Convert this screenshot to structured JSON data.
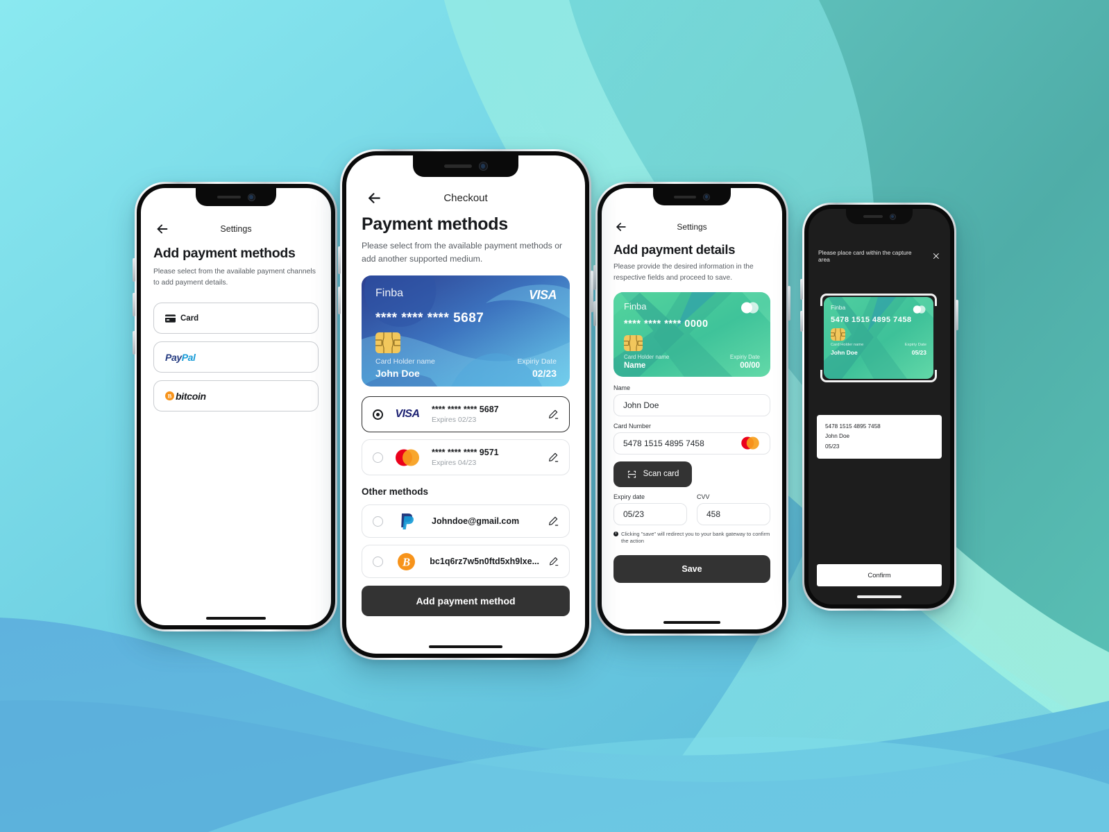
{
  "background": {
    "gradient_top_left": "#8AE9F0",
    "gradient_top_right": "#4FA8A5",
    "gradient_bottom_left": "#5DB1DB",
    "gradient_bottom_right": "#9BEFE3",
    "wave_mint": "#9EE9D2",
    "wave_cyan": "#7CE3EE",
    "wave_blue": "#5FB3DE"
  },
  "phone1": {
    "nav": {
      "back_icon": "arrow-left-icon",
      "title": "Settings"
    },
    "heading": "Add payment methods",
    "subtitle": "Please select from the available payment channels to add payment details.",
    "options": [
      {
        "id": "card",
        "label": "Card",
        "icon": "credit-card-icon"
      },
      {
        "id": "paypal",
        "label": "PayPal",
        "icon": "paypal-logo"
      },
      {
        "id": "bitcoin",
        "label": "bitcoin",
        "icon": "bitcoin-logo"
      }
    ]
  },
  "phone2": {
    "nav": {
      "back_icon": "arrow-left-icon",
      "title": "Checkout"
    },
    "heading": "Payment methods",
    "subtitle": "Please select from the available payment methods or add another supported medium.",
    "card": {
      "brand": "Finba",
      "network": "VISA",
      "number": "**** **** **** 5687",
      "holder_label": "Card Holder name",
      "holder_name": "John Doe",
      "expiry_label": "Expiriy Date",
      "expiry_value": "02/23",
      "color_from": "#2B3F8C",
      "color_to": "#64C8E8"
    },
    "methods": [
      {
        "icon": "visa-logo",
        "title": "**** **** **** 5687",
        "subtitle": "Expires 02/23",
        "selected": true,
        "edit_icon": "pencil-icon"
      },
      {
        "icon": "mastercard-logo",
        "title": "**** **** **** 9571",
        "subtitle": "Expires 04/23",
        "selected": false,
        "edit_icon": "pencil-icon"
      }
    ],
    "other_heading": "Other methods",
    "other_methods": [
      {
        "icon": "paypal-logo",
        "title": "Johndoe@gmail.com",
        "selected": false,
        "edit_icon": "pencil-icon"
      },
      {
        "icon": "bitcoin-logo",
        "title": "bc1q6rz7w5n0ftd5xh9lxe...",
        "selected": false,
        "edit_icon": "pencil-icon"
      }
    ],
    "primary_button": "Add payment method"
  },
  "phone3": {
    "nav": {
      "back_icon": "arrow-left-icon",
      "title": "Settings"
    },
    "heading": "Add payment details",
    "subtitle": "Please provide the desired information in the respective fields and proceed to save.",
    "card": {
      "brand": "Finba",
      "network": "mastercard-logo",
      "number": "**** **** **** 0000",
      "holder_label": "Card Holder name",
      "holder_name": "Name",
      "expiry_label": "Expiriy Date",
      "expiry_value": "00/00",
      "color_from": "#4FD39B",
      "color_to": "#2BA88D"
    },
    "fields": {
      "name_label": "Name",
      "name_value": "John Doe",
      "card_number_label": "Card Number",
      "card_number_value": "5478 1515 4895 7458",
      "card_number_icon": "mastercard-logo",
      "expiry_label": "Expiry date",
      "expiry_value": "05/23",
      "cvv_label": "CVV",
      "cvv_value": "458"
    },
    "scan_button": {
      "label": "Scan card",
      "icon": "scan-frame-icon"
    },
    "note": "Clicking \"save\" will redirect you to your bank gateway to confirm the action",
    "note_icon": "info-icon",
    "save_button": "Save"
  },
  "phone4": {
    "instruction": "Please place card within the capture area",
    "close_icon": "close-icon",
    "card": {
      "brand": "Finba",
      "network": "mastercard-logo",
      "number": "5478 1515 4895 7458",
      "holder_label": "Card Holder name",
      "holder_name": "John Doe",
      "expiry_label": "Expiriy Date",
      "expiry_value": "05/23"
    },
    "result": {
      "line1": "5478 1515 4895 7458",
      "line2": "John Doe",
      "line3": "05/23"
    },
    "confirm_button": "Confirm"
  }
}
